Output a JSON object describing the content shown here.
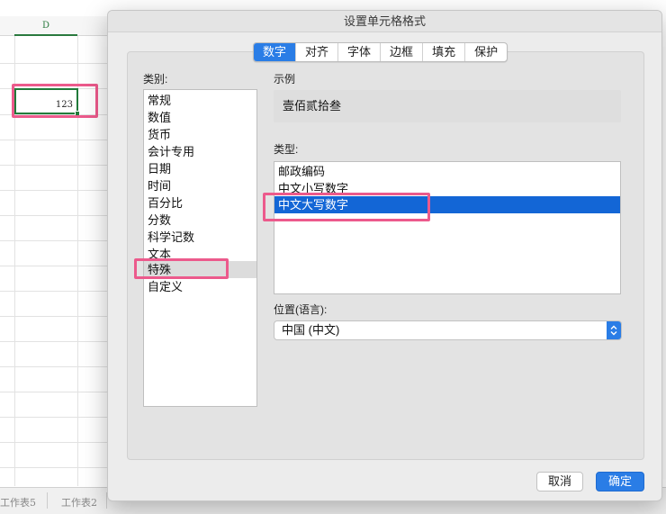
{
  "sheet": {
    "column_header": "D",
    "cell_value": "123",
    "tabs": [
      "工作表5",
      "工作表2"
    ]
  },
  "dialog": {
    "title": "设置单元格格式",
    "tabs": [
      {
        "label": "数字",
        "active": true
      },
      {
        "label": "对齐",
        "active": false
      },
      {
        "label": "字体",
        "active": false
      },
      {
        "label": "边框",
        "active": false
      },
      {
        "label": "填充",
        "active": false
      },
      {
        "label": "保护",
        "active": false
      }
    ],
    "category_label": "类别:",
    "categories": [
      "常规",
      "数值",
      "货币",
      "会计专用",
      "日期",
      "时间",
      "百分比",
      "分数",
      "科学记数",
      "文本",
      "特殊",
      "自定义"
    ],
    "selected_category": "特殊",
    "sample_label": "示例",
    "sample_value": "壹佰贰拾叁",
    "type_label": "类型:",
    "types": [
      "邮政编码",
      "中文小写数字",
      "中文大写数字"
    ],
    "selected_type": "中文大写数字",
    "locale_label": "位置(语言):",
    "locale_value": "中国 (中文)",
    "buttons": {
      "cancel": "取消",
      "ok": "确定"
    }
  },
  "colors": {
    "accent": "#2a7de6",
    "selection": "#1366d6",
    "annotation": "#ec5a8c",
    "cell_border": "#217a3a"
  }
}
